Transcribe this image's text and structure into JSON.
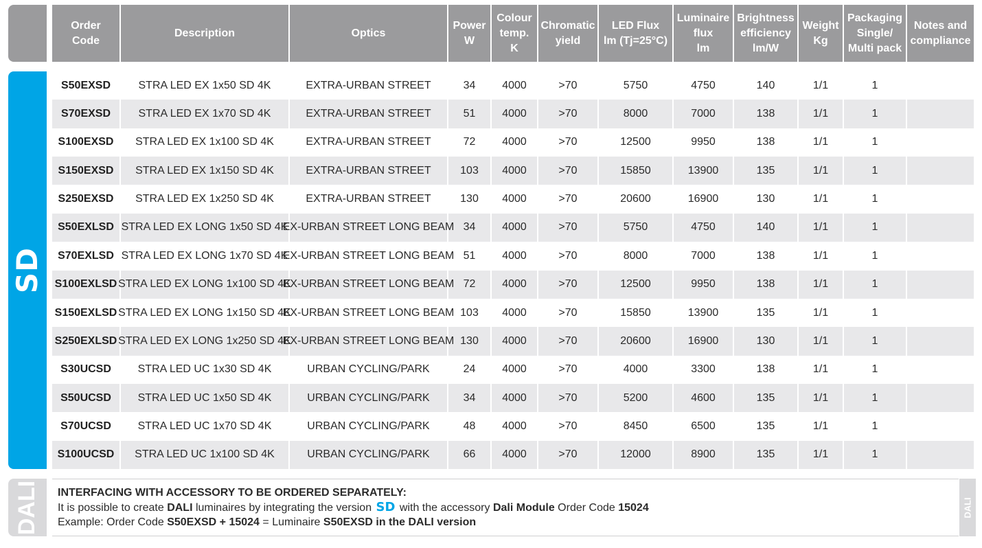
{
  "headers": [
    "Order\nCode",
    "Description",
    "Optics",
    "Power\nW",
    "Colour\ntemp.\nK",
    "Chromatic\nyield",
    "LED Flux\nlm (Tj=25°C)",
    "Luminaire\nflux\nlm",
    "Brightness\nefficiency\nlm/W",
    "Weight\nKg",
    "Packaging\nSingle/\nMulti pack",
    "Notes and\ncompliance"
  ],
  "group_label": "SD",
  "rows": [
    {
      "code": "S50EXSD",
      "desc": "STRA LED EX 1x50 SD 4K",
      "optics": "EXTRA-URBAN STREET",
      "power": "34",
      "temp": "4000",
      "yield": ">70",
      "ledflux": "5750",
      "lumflux": "4750",
      "eff": "140",
      "weight": "1/1",
      "pack": "1",
      "notes": ""
    },
    {
      "code": "S70EXSD",
      "desc": "STRA LED EX 1x70 SD 4K",
      "optics": "EXTRA-URBAN STREET",
      "power": "51",
      "temp": "4000",
      "yield": ">70",
      "ledflux": "8000",
      "lumflux": "7000",
      "eff": "138",
      "weight": "1/1",
      "pack": "1",
      "notes": ""
    },
    {
      "code": "S100EXSD",
      "desc": "STRA LED EX 1x100 SD 4K",
      "optics": "EXTRA-URBAN STREET",
      "power": "72",
      "temp": "4000",
      "yield": ">70",
      "ledflux": "12500",
      "lumflux": "9950",
      "eff": "138",
      "weight": "1/1",
      "pack": "1",
      "notes": ""
    },
    {
      "code": "S150EXSD",
      "desc": "STRA LED EX 1x150 SD 4K",
      "optics": "EXTRA-URBAN STREET",
      "power": "103",
      "temp": "4000",
      "yield": ">70",
      "ledflux": "15850",
      "lumflux": "13900",
      "eff": "135",
      "weight": "1/1",
      "pack": "1",
      "notes": ""
    },
    {
      "code": "S250EXSD",
      "desc": "STRA LED EX 1x250 SD 4K",
      "optics": "EXTRA-URBAN STREET",
      "power": "130",
      "temp": "4000",
      "yield": ">70",
      "ledflux": "20600",
      "lumflux": "16900",
      "eff": "130",
      "weight": "1/1",
      "pack": "1",
      "notes": ""
    },
    {
      "code": "S50EXLSD",
      "desc": "STRA LED EX LONG 1x50 SD 4K",
      "optics": "EX-URBAN STREET LONG BEAM",
      "power": "34",
      "temp": "4000",
      "yield": ">70",
      "ledflux": "5750",
      "lumflux": "4750",
      "eff": "140",
      "weight": "1/1",
      "pack": "1",
      "notes": ""
    },
    {
      "code": "S70EXLSD",
      "desc": "STRA LED EX LONG 1x70 SD 4K",
      "optics": "EX-URBAN STREET LONG BEAM",
      "power": "51",
      "temp": "4000",
      "yield": ">70",
      "ledflux": "8000",
      "lumflux": "7000",
      "eff": "138",
      "weight": "1/1",
      "pack": "1",
      "notes": ""
    },
    {
      "code": "S100EXLSD",
      "desc": "STRA LED EX LONG 1x100 SD 4K",
      "optics": "EX-URBAN STREET LONG BEAM",
      "power": "72",
      "temp": "4000",
      "yield": ">70",
      "ledflux": "12500",
      "lumflux": "9950",
      "eff": "138",
      "weight": "1/1",
      "pack": "1",
      "notes": ""
    },
    {
      "code": "S150EXLSD",
      "desc": "STRA LED EX LONG 1x150 SD 4K",
      "optics": "EX-URBAN STREET LONG BEAM",
      "power": "103",
      "temp": "4000",
      "yield": ">70",
      "ledflux": "15850",
      "lumflux": "13900",
      "eff": "135",
      "weight": "1/1",
      "pack": "1",
      "notes": ""
    },
    {
      "code": "S250EXLSD",
      "desc": "STRA LED EX LONG 1x250 SD 4K",
      "optics": "EX-URBAN STREET LONG BEAM",
      "power": "130",
      "temp": "4000",
      "yield": ">70",
      "ledflux": "20600",
      "lumflux": "16900",
      "eff": "130",
      "weight": "1/1",
      "pack": "1",
      "notes": ""
    },
    {
      "code": "S30UCSD",
      "desc": "STRA LED UC 1x30 SD 4K",
      "optics": "URBAN CYCLING/PARK",
      "power": "24",
      "temp": "4000",
      "yield": ">70",
      "ledflux": "4000",
      "lumflux": "3300",
      "eff": "138",
      "weight": "1/1",
      "pack": "1",
      "notes": ""
    },
    {
      "code": "S50UCSD",
      "desc": "STRA LED UC 1x50 SD 4K",
      "optics": "URBAN CYCLING/PARK",
      "power": "34",
      "temp": "4000",
      "yield": ">70",
      "ledflux": "5200",
      "lumflux": "4600",
      "eff": "135",
      "weight": "1/1",
      "pack": "1",
      "notes": ""
    },
    {
      "code": "S70UCSD",
      "desc": "STRA LED UC 1x70 SD 4K",
      "optics": "URBAN CYCLING/PARK",
      "power": "48",
      "temp": "4000",
      "yield": ">70",
      "ledflux": "8450",
      "lumflux": "6500",
      "eff": "135",
      "weight": "1/1",
      "pack": "1",
      "notes": ""
    },
    {
      "code": "S100UCSD",
      "desc": "STRA LED UC 1x100 SD 4K",
      "optics": "URBAN CYCLING/PARK",
      "power": "66",
      "temp": "4000",
      "yield": ">70",
      "ledflux": "12000",
      "lumflux": "8900",
      "eff": "135",
      "weight": "1/1",
      "pack": "1",
      "notes": ""
    }
  ],
  "note": {
    "side_label": "DALI",
    "title": "INTERFACING WITH ACCESSORY TO BE ORDERED SEPARATELY:",
    "line2_a": "It is possible to create ",
    "line2_b": "DALI",
    "line2_c": " luminaires by integrating the version ",
    "line2_sd": "SD",
    "line2_d": " with the accessory ",
    "line2_e": "Dali Module",
    "line2_f": " Order Code ",
    "line2_g": "15024",
    "line3_a": "Example: Order Code ",
    "line3_b": "S50EXSD + 15024",
    "line3_c": " = Luminaire ",
    "line3_d": "S50EXSD in the DALI version",
    "right_label": "DALI"
  },
  "colors": {
    "header_bg": "#9b9b9d",
    "accent": "#00a5e6",
    "row_alt": "#e8e8ea"
  }
}
